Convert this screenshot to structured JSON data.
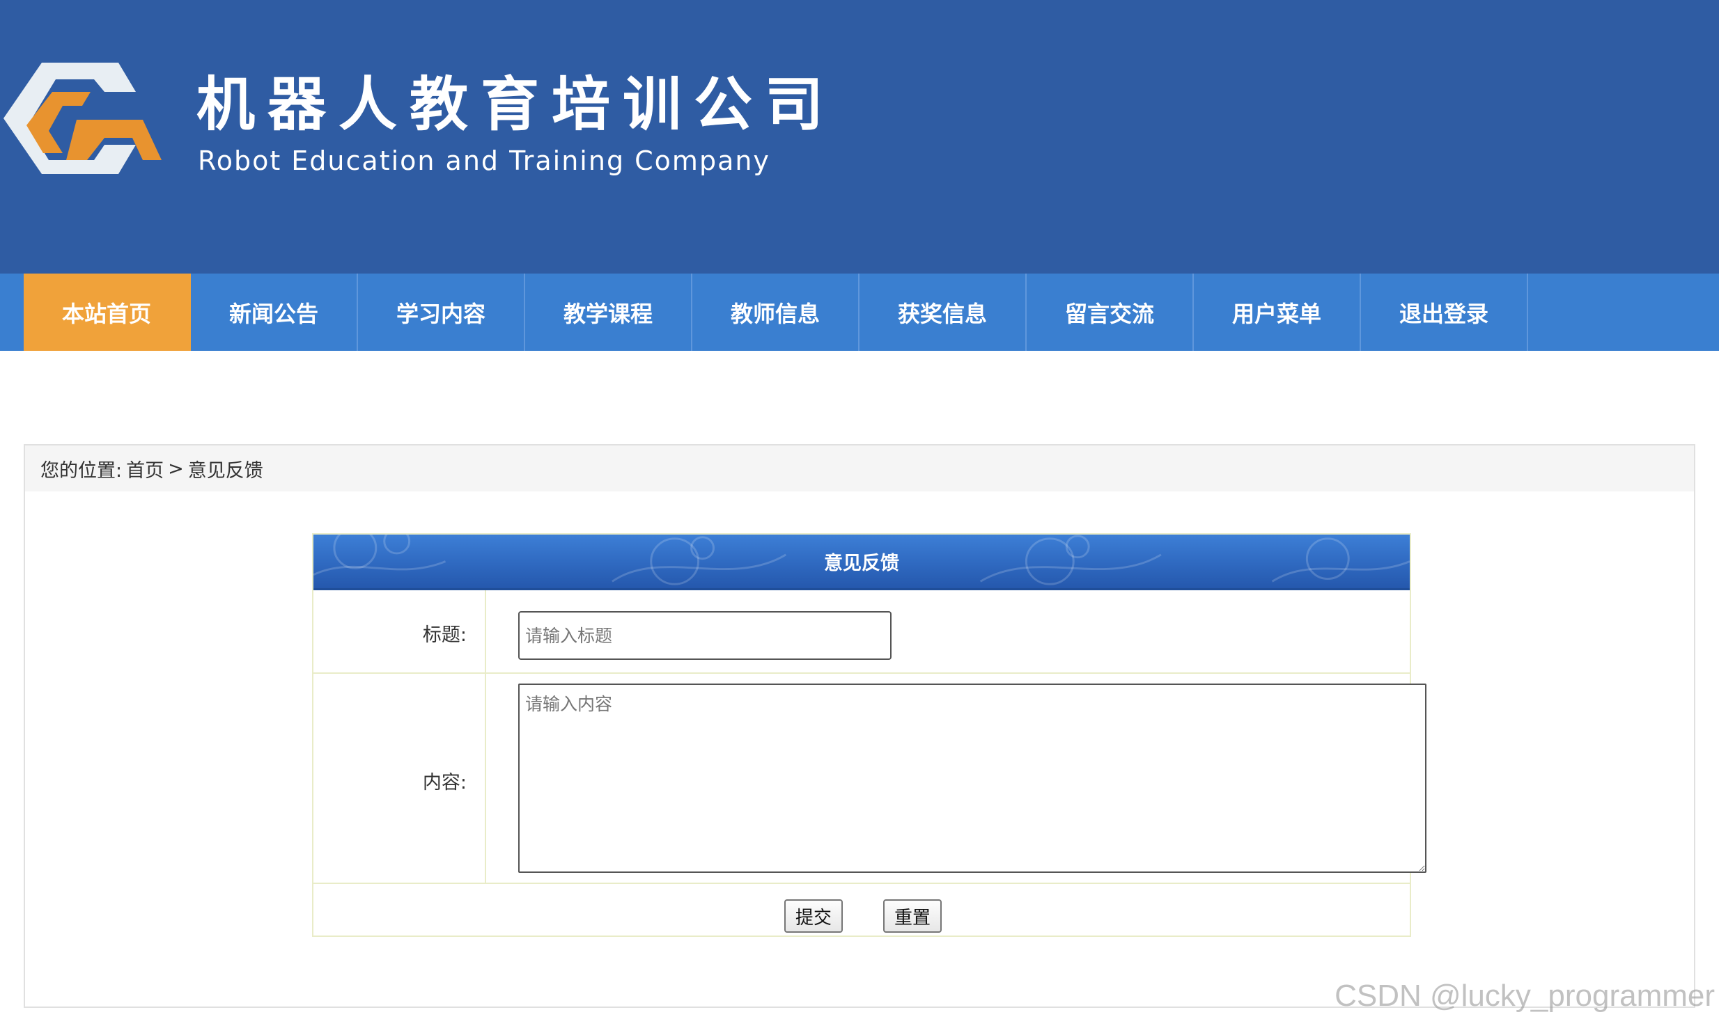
{
  "header": {
    "title_cn": "机器人教育培训公司",
    "title_en": "Robot Education and Training Company",
    "logo_icon": "company-logo-icon",
    "background_color": "#2f5ca3"
  },
  "nav": {
    "background_color": "#3a7fd0",
    "active_color": "#f0a23a",
    "items": [
      {
        "label": "本站首页",
        "active": true
      },
      {
        "label": "新闻公告",
        "active": false
      },
      {
        "label": "学习内容",
        "active": false
      },
      {
        "label": "教学课程",
        "active": false
      },
      {
        "label": "教师信息",
        "active": false
      },
      {
        "label": "获奖信息",
        "active": false
      },
      {
        "label": "留言交流",
        "active": false
      },
      {
        "label": "用户菜单",
        "active": false
      },
      {
        "label": "退出登录",
        "active": false
      }
    ]
  },
  "breadcrumb": {
    "prefix": "您的位置:",
    "home": "首页",
    "separator": ">",
    "current": "意见反馈"
  },
  "form": {
    "heading": "意见反馈",
    "title_label": "标题:",
    "title_placeholder": "请输入标题",
    "content_label": "内容:",
    "content_placeholder": "请输入内容",
    "submit_label": "提交",
    "reset_label": "重置"
  },
  "watermark": "CSDN @lucky_programmer"
}
